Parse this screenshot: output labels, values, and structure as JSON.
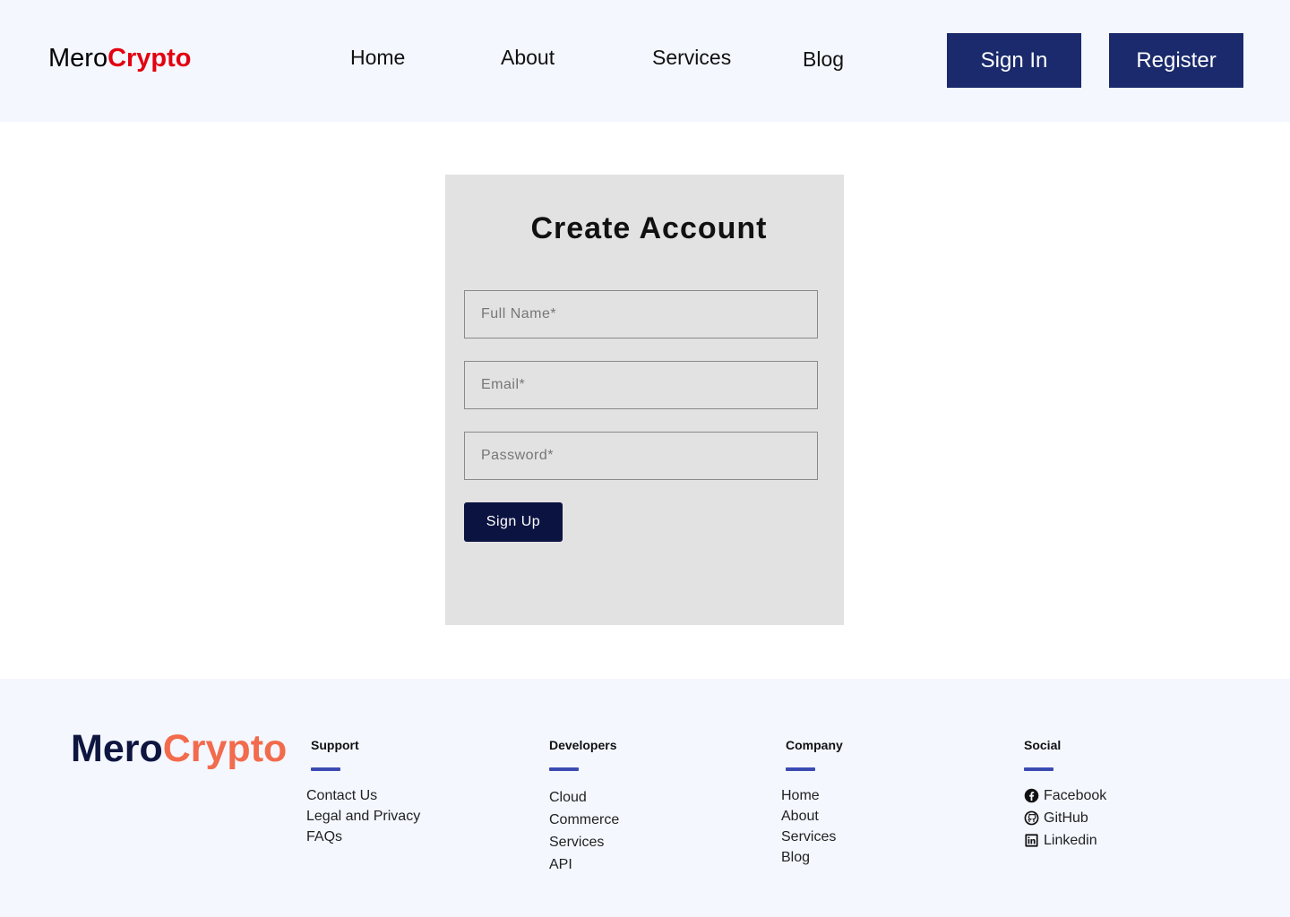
{
  "header": {
    "brand_prefix": "Mero",
    "brand_accent": "Crypto",
    "nav": [
      {
        "label": "Home"
      },
      {
        "label": "About"
      },
      {
        "label": "Services"
      },
      {
        "label": "Blog"
      }
    ],
    "signin_label": "Sign In",
    "register_label": "Register"
  },
  "form": {
    "title": "Create Account",
    "fullname_placeholder": "Full Name*",
    "email_placeholder": "Email*",
    "password_placeholder": "Password*",
    "submit_label": "Sign Up"
  },
  "footer": {
    "brand_prefix": "Mero",
    "brand_accent": "Crypto",
    "columns": [
      {
        "heading": "Support",
        "links": [
          "Contact Us",
          "Legal and Privacy",
          "FAQs"
        ]
      },
      {
        "heading": "Developers",
        "links": [
          "Cloud",
          "Commerce",
          "Services",
          "API"
        ]
      },
      {
        "heading": "Company",
        "links": [
          "Home",
          "About",
          "Services",
          "Blog"
        ]
      },
      {
        "heading": "Social",
        "links": [
          {
            "label": "Facebook",
            "icon": "facebook-icon"
          },
          {
            "label": "GitHub",
            "icon": "github-icon"
          },
          {
            "label": "Linkedin",
            "icon": "linkedin-icon"
          }
        ]
      }
    ]
  },
  "colors": {
    "header_bg": "#f4f7fe",
    "brand_accent": "#e3000f",
    "button_bg": "#1a2a6c",
    "card_bg": "#e2e2e2",
    "signup_bg": "#0b1341",
    "footer_brand": "#0e1640",
    "footer_accent": "#f26b4c",
    "footer_bar": "#3b4bb2"
  }
}
